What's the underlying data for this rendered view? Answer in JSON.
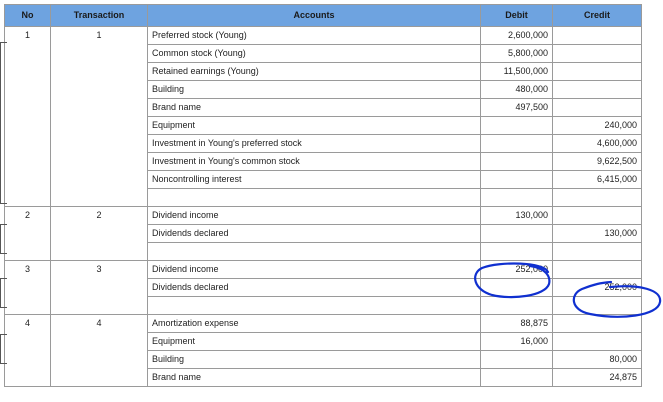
{
  "headers": {
    "no": "No",
    "transaction": "Transaction",
    "accounts": "Accounts",
    "debit": "Debit",
    "credit": "Credit"
  },
  "groups": [
    {
      "no": "1",
      "transaction": "1",
      "rows": [
        {
          "account": "Preferred stock (Young)",
          "debit": "2,600,000",
          "credit": ""
        },
        {
          "account": "Common stock (Young)",
          "debit": "5,800,000",
          "credit": ""
        },
        {
          "account": "Retained earnings (Young)",
          "debit": "11,500,000",
          "credit": ""
        },
        {
          "account": "Building",
          "debit": "480,000",
          "credit": ""
        },
        {
          "account": "Brand name",
          "debit": "497,500",
          "credit": ""
        },
        {
          "account": "Equipment",
          "debit": "",
          "credit": "240,000"
        },
        {
          "account": "Investment in Young's preferred stock",
          "debit": "",
          "credit": "4,600,000"
        },
        {
          "account": "Investment in Young's common stock",
          "debit": "",
          "credit": "9,622,500"
        },
        {
          "account": "Noncontrolling interest",
          "debit": "",
          "credit": "6,415,000"
        }
      ]
    },
    {
      "no": "2",
      "transaction": "2",
      "rows": [
        {
          "account": "Dividend income",
          "debit": "130,000",
          "credit": ""
        },
        {
          "account": "Dividends declared",
          "debit": "",
          "credit": "130,000"
        }
      ]
    },
    {
      "no": "3",
      "transaction": "3",
      "rows": [
        {
          "account": "Dividend income",
          "debit": "252,000",
          "credit": ""
        },
        {
          "account": "Dividends declared",
          "debit": "",
          "credit": "252,000"
        }
      ]
    },
    {
      "no": "4",
      "transaction": "4",
      "rows": [
        {
          "account": "Amortization expense",
          "debit": "88,875",
          "credit": ""
        },
        {
          "account": "Equipment",
          "debit": "16,000",
          "credit": ""
        },
        {
          "account": "Building",
          "debit": "",
          "credit": "80,000"
        },
        {
          "account": "Brand name",
          "debit": "",
          "credit": "24,875"
        }
      ]
    }
  ],
  "annotation": {
    "color": "#1030d0"
  }
}
